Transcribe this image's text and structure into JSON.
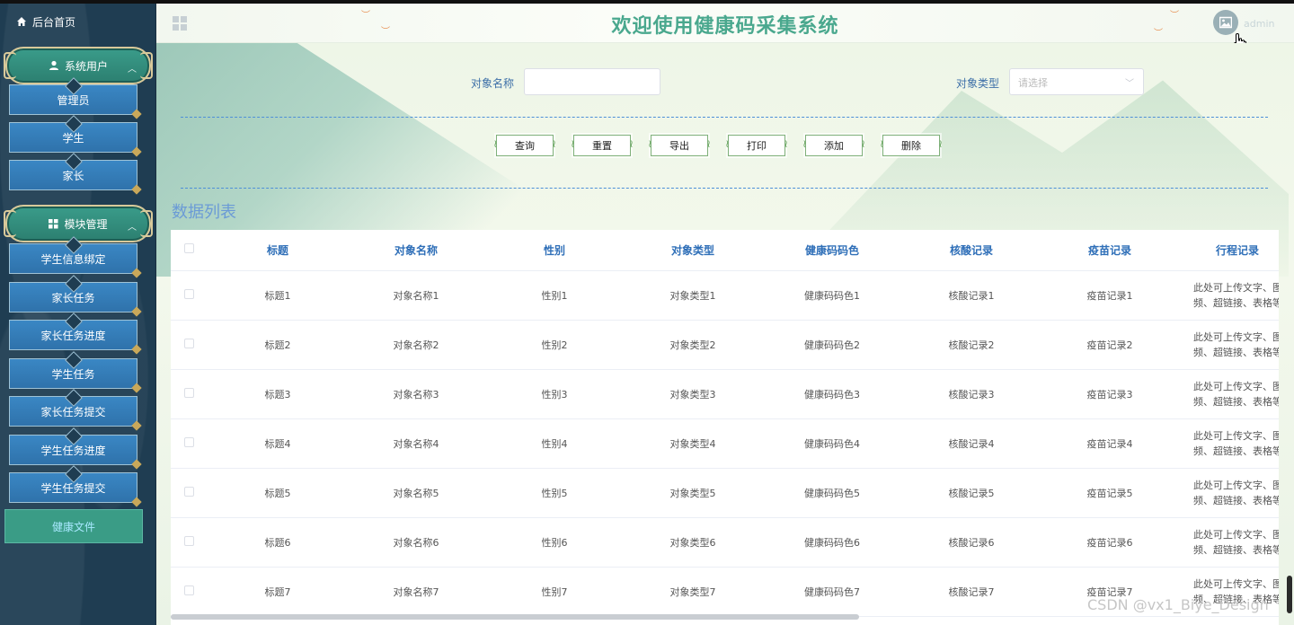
{
  "sidebar": {
    "home_label": "后台首页",
    "groups": [
      {
        "label": "系统用户",
        "icon": "user-icon",
        "items": [
          "管理员",
          "学生",
          "家长"
        ]
      },
      {
        "label": "模块管理",
        "icon": "grid-icon",
        "items": [
          "学生信息绑定",
          "家长任务",
          "家长任务进度",
          "学生任务",
          "家长任务提交",
          "学生任务进度",
          "学生任务提交",
          "健康文件"
        ]
      }
    ],
    "active_item": "健康文件"
  },
  "header": {
    "title": "欢迎使用健康码采集系统",
    "user": "admin"
  },
  "search": {
    "name_label": "对象名称",
    "name_value": "",
    "type_label": "对象类型",
    "type_placeholder": "请选择"
  },
  "buttons": {
    "query": "查询",
    "reset": "重置",
    "export": "导出",
    "print": "打印",
    "add": "添加",
    "delete": "删除"
  },
  "list_title": "数据列表",
  "table": {
    "columns": [
      "标题",
      "对象名称",
      "性别",
      "对象类型",
      "健康码码色",
      "核酸记录",
      "疫苗记录",
      "行程记录"
    ],
    "rows": [
      [
        "标题1",
        "对象名称1",
        "性别1",
        "对象类型1",
        "健康码码色1",
        "核酸记录1",
        "疫苗记录1"
      ],
      [
        "标题2",
        "对象名称2",
        "性别2",
        "对象类型2",
        "健康码码色2",
        "核酸记录2",
        "疫苗记录2"
      ],
      [
        "标题3",
        "对象名称3",
        "性别3",
        "对象类型3",
        "健康码码色3",
        "核酸记录3",
        "疫苗记录3"
      ],
      [
        "标题4",
        "对象名称4",
        "性别4",
        "对象类型4",
        "健康码码色4",
        "核酸记录4",
        "疫苗记录4"
      ],
      [
        "标题5",
        "对象名称5",
        "性别5",
        "对象类型5",
        "健康码码色5",
        "核酸记录5",
        "疫苗记录5"
      ],
      [
        "标题6",
        "对象名称6",
        "性别6",
        "对象类型6",
        "健康码码色6",
        "核酸记录6",
        "疫苗记录6"
      ],
      [
        "标题7",
        "对象名称7",
        "性别7",
        "对象类型7",
        "健康码码色7",
        "核酸记录7",
        "疫苗记录7"
      ]
    ],
    "trip_line1": "此处可上传文字、图",
    "trip_line2": "频、超链接、表格等"
  },
  "watermark": "CSDN @vx1_Biye_Design"
}
